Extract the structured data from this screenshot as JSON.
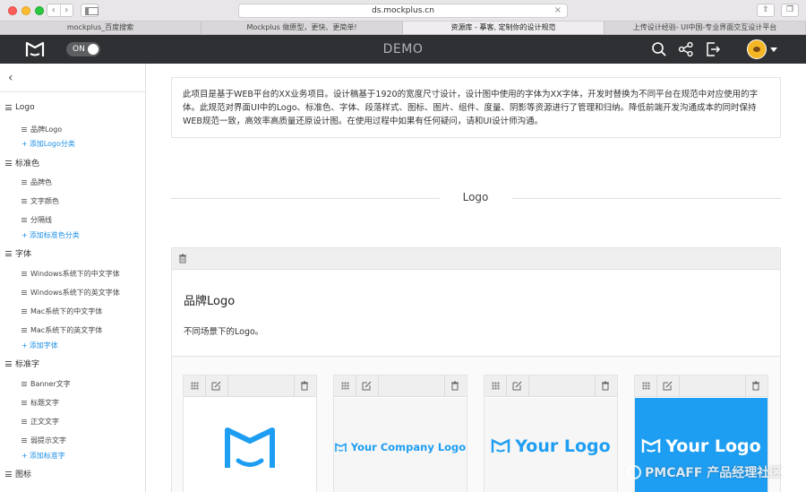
{
  "browser": {
    "url": "ds.mockplus.cn",
    "tabs": [
      "mockplus_百度搜索",
      "Mockplus 做原型，更快、更简单!",
      "资源库 - 摹客, 定制你的设计规范",
      "上传设计经验- UI中国-专业界面交互设计平台"
    ]
  },
  "app": {
    "title": "DEMO",
    "toggle_label": "ON"
  },
  "sidebar": {
    "sections": [
      {
        "label": "Logo",
        "items": [
          "品牌Logo"
        ],
        "add": "添加Logo分类"
      },
      {
        "label": "标准色",
        "items": [
          "品牌色",
          "文字颜色",
          "分隔线"
        ],
        "add": "添加标准色分类"
      },
      {
        "label": "字体",
        "items": [
          "Windows系统下的中文字体",
          "Windows系统下的英文字体",
          "Mac系统下的中文字体",
          "Mac系统下的英文字体"
        ],
        "add": "添加字体"
      },
      {
        "label": "标准字",
        "items": [
          "Banner文字",
          "标题文字",
          "正文文字",
          "弱提示文字"
        ],
        "add": "添加标准字"
      },
      {
        "label": "图标",
        "items": [],
        "add": ""
      }
    ]
  },
  "main": {
    "intro": "此项目是基于WEB平台的XX业务项目。设计稿基于1920的宽度尺寸设计，设计图中使用的字体为XX字体，开发时替换为不同平台在规范中对应使用的字体。此规范对界面UI中的Logo、标准色、字体、段落样式、图标、图片、组件、度量、阴影等资源进行了管理和归纳。降低前端开发沟通成本的同时保持WEB规范一致，高效率高质量还原设计图。在使用过程中如果有任何疑问，请和UI设计师沟通。",
    "section_title": "Logo",
    "card": {
      "title": "品牌Logo",
      "description": "不同场景下的Logo。",
      "tiles": [
        {
          "text": ""
        },
        {
          "text": "Your Company Logo"
        },
        {
          "text": "Your Logo"
        },
        {
          "text": "Your Logo"
        }
      ]
    }
  },
  "watermark": "PMCAFF 产品经理社区",
  "colors": {
    "accent": "#1e9ef2",
    "header": "#2f3033"
  }
}
